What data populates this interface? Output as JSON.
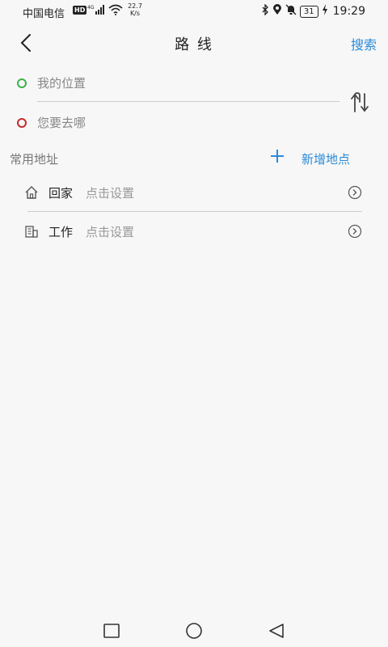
{
  "status_bar": {
    "carrier": "中国电信",
    "hd": "HD",
    "network": "4G",
    "speed_value": "22.7",
    "speed_unit": "K/s",
    "battery": "31",
    "time": "19:29"
  },
  "header": {
    "title": "路 线",
    "search_label": "搜索"
  },
  "route": {
    "from_placeholder": "我的位置",
    "to_placeholder": "您要去哪"
  },
  "common": {
    "title": "常用地址",
    "add_label": "新增地点",
    "items": [
      {
        "name": "回家",
        "hint": "点击设置",
        "icon": "home-icon"
      },
      {
        "name": "工作",
        "hint": "点击设置",
        "icon": "office-building-icon"
      }
    ]
  },
  "colors": {
    "accent": "#2a8bd8",
    "start_dot": "#3bb34a",
    "end_dot": "#c62b2b"
  }
}
